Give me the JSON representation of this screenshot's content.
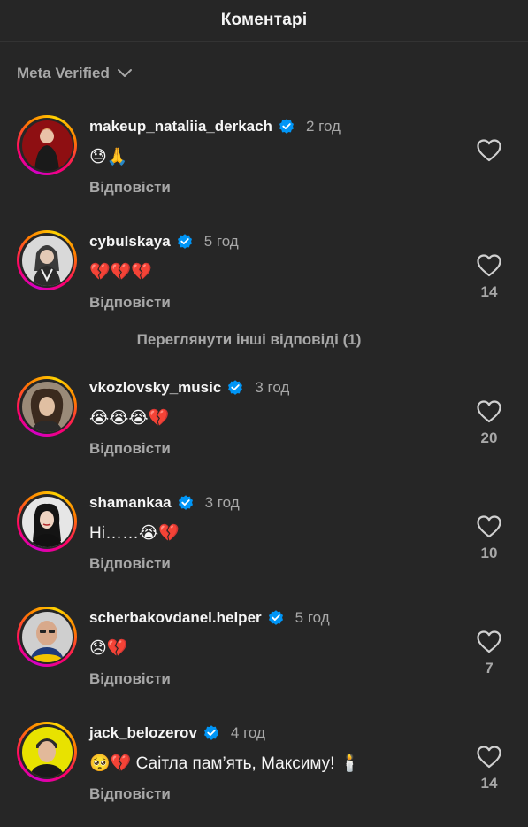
{
  "header": {
    "title": "Коментарі"
  },
  "filter": {
    "label": "Meta Verified"
  },
  "reply_label": "Відповісти",
  "more_replies": "Переглянути інші відповіді (1)",
  "colors": {
    "background": "#262626",
    "verified": "#0095f6",
    "secondary_text": "#a8a8a8"
  },
  "comments": [
    {
      "username": "makeup_nataliia_derkach",
      "time": "2 год",
      "text": "😓🙏",
      "likes": ""
    },
    {
      "username": "cybulskaya",
      "time": "5 год",
      "text": "💔💔💔",
      "likes": "14"
    },
    {
      "username": "vkozlovsky_music",
      "time": "3 год",
      "text": "😭😭😭💔",
      "likes": "20"
    },
    {
      "username": "shamankaa",
      "time": "3 год",
      "text": "Ні……😭💔",
      "likes": "10"
    },
    {
      "username": "scherbakovdanel.helper",
      "time": "5 год",
      "text": "😞💔",
      "likes": "7"
    },
    {
      "username": "jack_belozerov",
      "time": "4 год",
      "text": "🥺💔 Саітла пам’ять, Максиму! 🕯️",
      "likes": "14"
    }
  ]
}
